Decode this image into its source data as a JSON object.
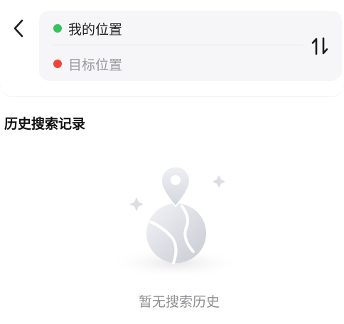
{
  "route": {
    "start_label": "我的位置",
    "end_placeholder": "目标位置",
    "start_dot_color": "#34c259",
    "end_dot_color": "#f0453a"
  },
  "icons": {
    "back": "chevron-left-icon",
    "swap": "swap-vertical-icon"
  },
  "history": {
    "title": "历史搜索记录",
    "empty_text": "暂无搜索历史"
  }
}
